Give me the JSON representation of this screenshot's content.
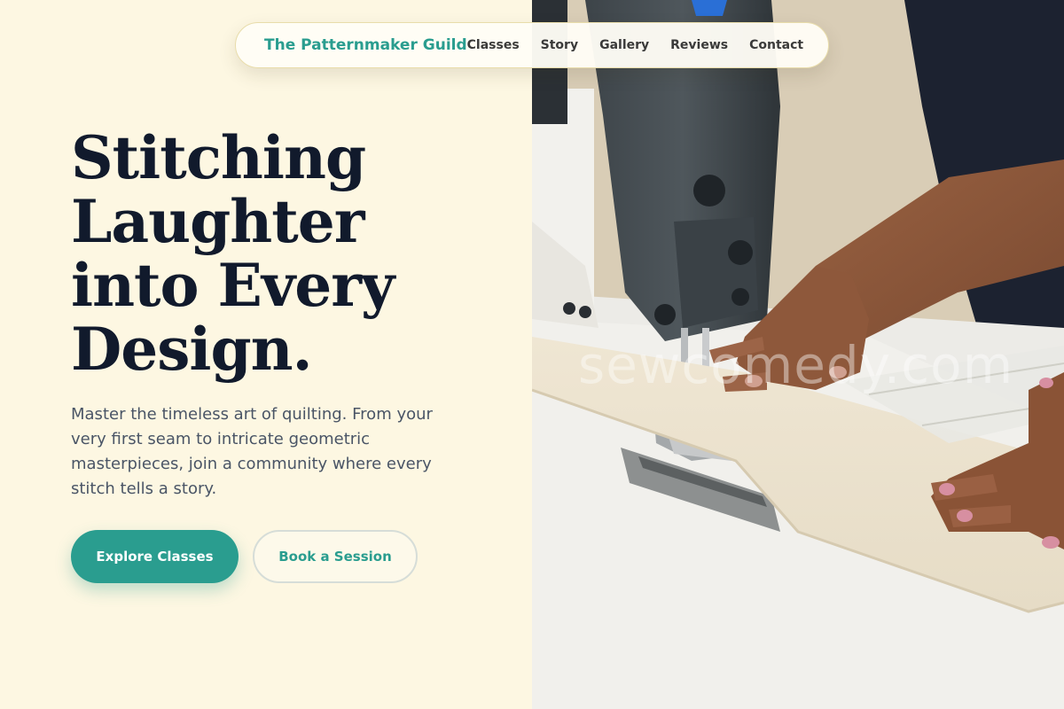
{
  "nav": {
    "brand": "The Patternmaker Guild",
    "links": [
      "Classes",
      "Story",
      "Gallery",
      "Reviews",
      "Contact"
    ]
  },
  "hero": {
    "title_lines": [
      "Stitching",
      "Laughter",
      "into Every",
      "Design."
    ],
    "description": "Master the timeless art of quilting. From your very first seam to intricate geometric masterpieces, join a community where every stitch tells a story.",
    "primary_button": "Explore Classes",
    "secondary_button": "Book a Session"
  },
  "photo": {
    "subject": "sewing-machine-with-hands",
    "watermark": "sewcomedy.com"
  },
  "colors": {
    "background": "#fdf7e2",
    "accent": "#2a9d8f",
    "heading": "#111a2c",
    "body_text": "#4a5566"
  }
}
